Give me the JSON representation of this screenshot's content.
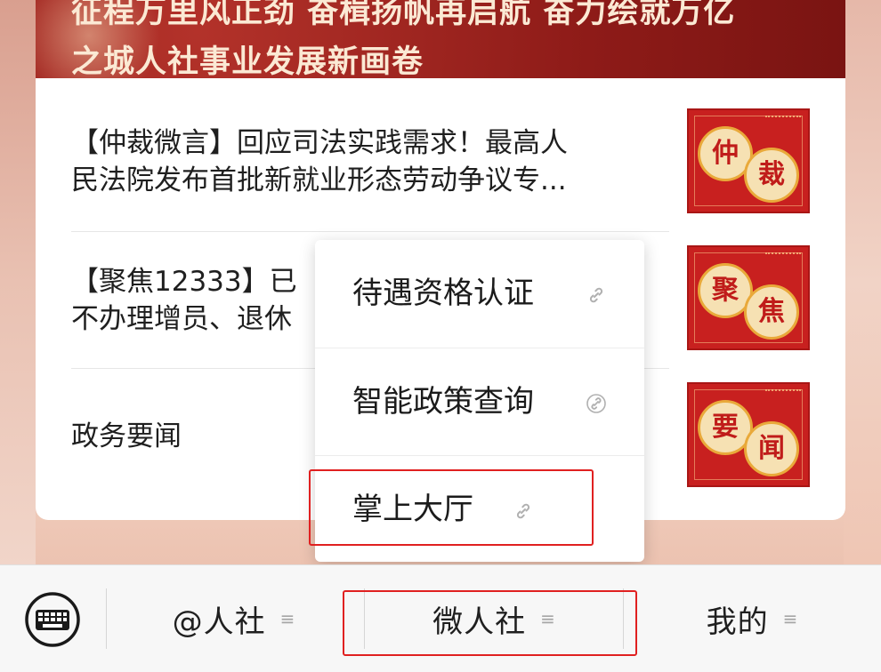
{
  "banner": {
    "title_line1": "征程万里风正劲 奋楫扬帆再启航 奋力绘就万亿",
    "title_line2": "之城人社事业发展新画卷"
  },
  "articles": [
    {
      "line1": "【仲裁微言】回应司法实践需求！最高人",
      "line2": "民法院发布首批新就业形态劳动争议专...",
      "thumb_chars": [
        "仲",
        "裁"
      ]
    },
    {
      "line1": "【聚焦12333】已",
      "line2": "不办理增员、退休",
      "thumb_chars": [
        "聚",
        "焦"
      ]
    },
    {
      "line1": "政务要闻",
      "thumb_chars": [
        "要",
        "闻"
      ]
    }
  ],
  "popup_menu": {
    "items": [
      {
        "label": "待遇资格认证",
        "icon": "link-icon"
      },
      {
        "label": "智能政策查询",
        "icon": "link-icon"
      },
      {
        "label": "掌上大厅",
        "icon": "link-icon"
      }
    ]
  },
  "tabbar": {
    "keyboard_icon": "keyboard-icon",
    "tabs": [
      {
        "label": "@人社",
        "menu_glyph": "≡"
      },
      {
        "label": "微人社",
        "menu_glyph": "≡"
      },
      {
        "label": "我的",
        "menu_glyph": "≡"
      }
    ]
  },
  "colors": {
    "highlight": "#e02020",
    "banner_red": "#8e1b18",
    "thumb_red": "#c8201f"
  }
}
